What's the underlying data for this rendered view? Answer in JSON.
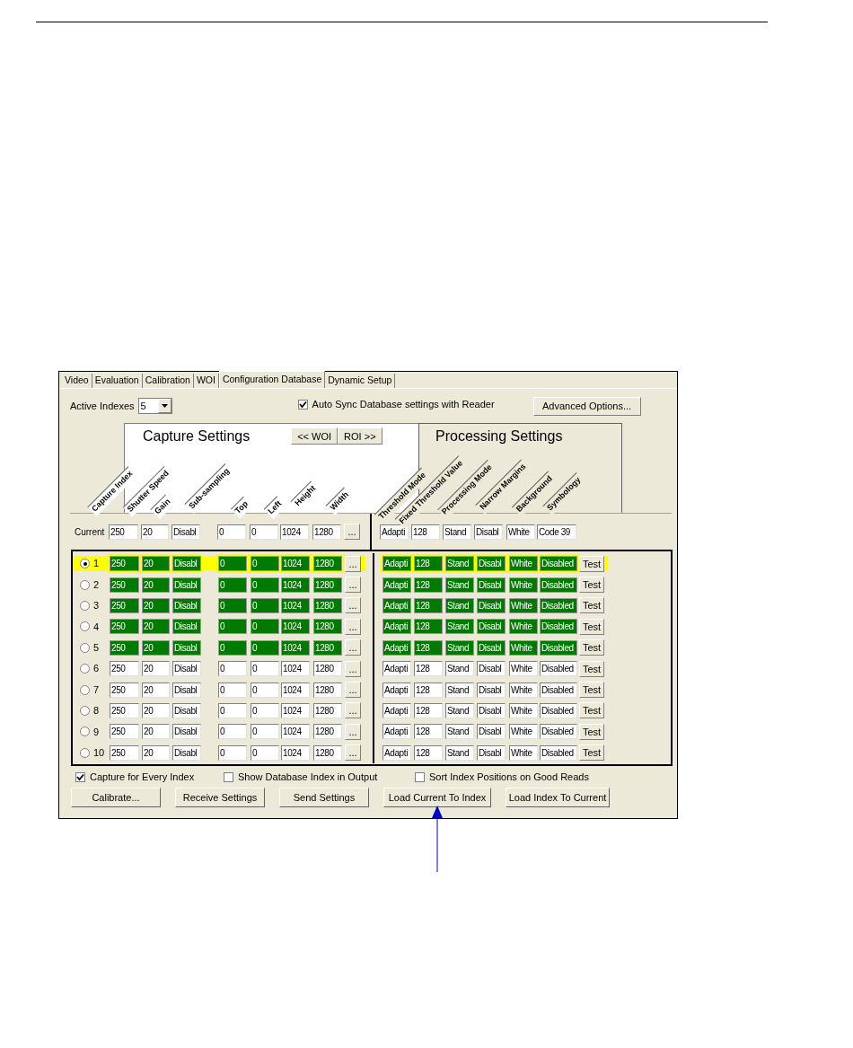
{
  "tabs": [
    {
      "label": "Video",
      "selected": false
    },
    {
      "label": "Evaluation",
      "selected": false
    },
    {
      "label": "Calibration",
      "selected": false
    },
    {
      "label": "WOI",
      "selected": false
    },
    {
      "label": "Configuration Database",
      "selected": true
    },
    {
      "label": "Dynamic Setup",
      "selected": false
    }
  ],
  "active_indexes": {
    "label": "Active Indexes",
    "value": "5"
  },
  "auto_sync": {
    "label": "Auto Sync Database settings with Reader",
    "checked": true
  },
  "advanced_button": "Advanced Options...",
  "capture_panel": {
    "title": "Capture Settings",
    "buttons": [
      "<< WOI",
      "ROI >>"
    ],
    "columns": [
      "Capture Index",
      "Shutter Speed",
      "Gain",
      "Sub-sampling",
      "Top",
      "Left",
      "Height",
      "Width"
    ]
  },
  "processing_panel": {
    "title": "Processing Settings",
    "columns": [
      "Threshold Mode",
      "Fixed Threshold Value",
      "Processing Mode",
      "Narrow Margins",
      "Background",
      "Symbology"
    ]
  },
  "current": {
    "label": "Current",
    "capture": [
      "250",
      "20",
      "Disabl",
      "0",
      "0",
      "1024",
      "1280"
    ],
    "more": "...",
    "processing": [
      "Adapti",
      "128",
      "Stand",
      "Disabl",
      "White",
      "Code 39"
    ]
  },
  "rows": [
    {
      "index": "1",
      "selected": true,
      "active": true,
      "capture": [
        "250",
        "20",
        "Disabl",
        "0",
        "0",
        "1024",
        "1280"
      ],
      "more": "...",
      "processing": [
        "Adapti",
        "128",
        "Stand",
        "Disabl",
        "White",
        "Disabled"
      ],
      "test": "Test"
    },
    {
      "index": "2",
      "selected": false,
      "active": true,
      "capture": [
        "250",
        "20",
        "Disabl",
        "0",
        "0",
        "1024",
        "1280"
      ],
      "more": "...",
      "processing": [
        "Adapti",
        "128",
        "Stand",
        "Disabl",
        "White",
        "Disabled"
      ],
      "test": "Test"
    },
    {
      "index": "3",
      "selected": false,
      "active": true,
      "capture": [
        "250",
        "20",
        "Disabl",
        "0",
        "0",
        "1024",
        "1280"
      ],
      "more": "...",
      "processing": [
        "Adapti",
        "128",
        "Stand",
        "Disabl",
        "White",
        "Disabled"
      ],
      "test": "Test"
    },
    {
      "index": "4",
      "selected": false,
      "active": true,
      "capture": [
        "250",
        "20",
        "Disabl",
        "0",
        "0",
        "1024",
        "1280"
      ],
      "more": "...",
      "processing": [
        "Adapti",
        "128",
        "Stand",
        "Disabl",
        "White",
        "Disabled"
      ],
      "test": "Test"
    },
    {
      "index": "5",
      "selected": false,
      "active": true,
      "capture": [
        "250",
        "20",
        "Disabl",
        "0",
        "0",
        "1024",
        "1280"
      ],
      "more": "...",
      "processing": [
        "Adapti",
        "128",
        "Stand",
        "Disabl",
        "White",
        "Disabled"
      ],
      "test": "Test"
    },
    {
      "index": "6",
      "selected": false,
      "active": false,
      "capture": [
        "250",
        "20",
        "Disabl",
        "0",
        "0",
        "1024",
        "1280"
      ],
      "more": "...",
      "processing": [
        "Adapti",
        "128",
        "Stand",
        "Disabl",
        "White",
        "Disabled"
      ],
      "test": "Test"
    },
    {
      "index": "7",
      "selected": false,
      "active": false,
      "capture": [
        "250",
        "20",
        "Disabl",
        "0",
        "0",
        "1024",
        "1280"
      ],
      "more": "...",
      "processing": [
        "Adapti",
        "128",
        "Stand",
        "Disabl",
        "White",
        "Disabled"
      ],
      "test": "Test"
    },
    {
      "index": "8",
      "selected": false,
      "active": false,
      "capture": [
        "250",
        "20",
        "Disabl",
        "0",
        "0",
        "1024",
        "1280"
      ],
      "more": "...",
      "processing": [
        "Adapti",
        "128",
        "Stand",
        "Disabl",
        "White",
        "Disabled"
      ],
      "test": "Test"
    },
    {
      "index": "9",
      "selected": false,
      "active": false,
      "capture": [
        "250",
        "20",
        "Disabl",
        "0",
        "0",
        "1024",
        "1280"
      ],
      "more": "...",
      "processing": [
        "Adapti",
        "128",
        "Stand",
        "Disabl",
        "White",
        "Disabled"
      ],
      "test": "Test"
    },
    {
      "index": "10",
      "selected": false,
      "active": false,
      "capture": [
        "250",
        "20",
        "Disabl",
        "0",
        "0",
        "1024",
        "1280"
      ],
      "more": "...",
      "processing": [
        "Adapti",
        "128",
        "Stand",
        "Disabl",
        "White",
        "Disabled"
      ],
      "test": "Test"
    }
  ],
  "options": [
    {
      "label": "Capture for Every Index",
      "checked": true
    },
    {
      "label": "Show Database Index in Output",
      "checked": false
    },
    {
      "label": "Sort Index Positions on Good Reads",
      "checked": false
    }
  ],
  "buttons": [
    "Calibrate...",
    "Receive Settings",
    "Send Settings",
    "Load Current To Index",
    "Load Index To Current"
  ]
}
